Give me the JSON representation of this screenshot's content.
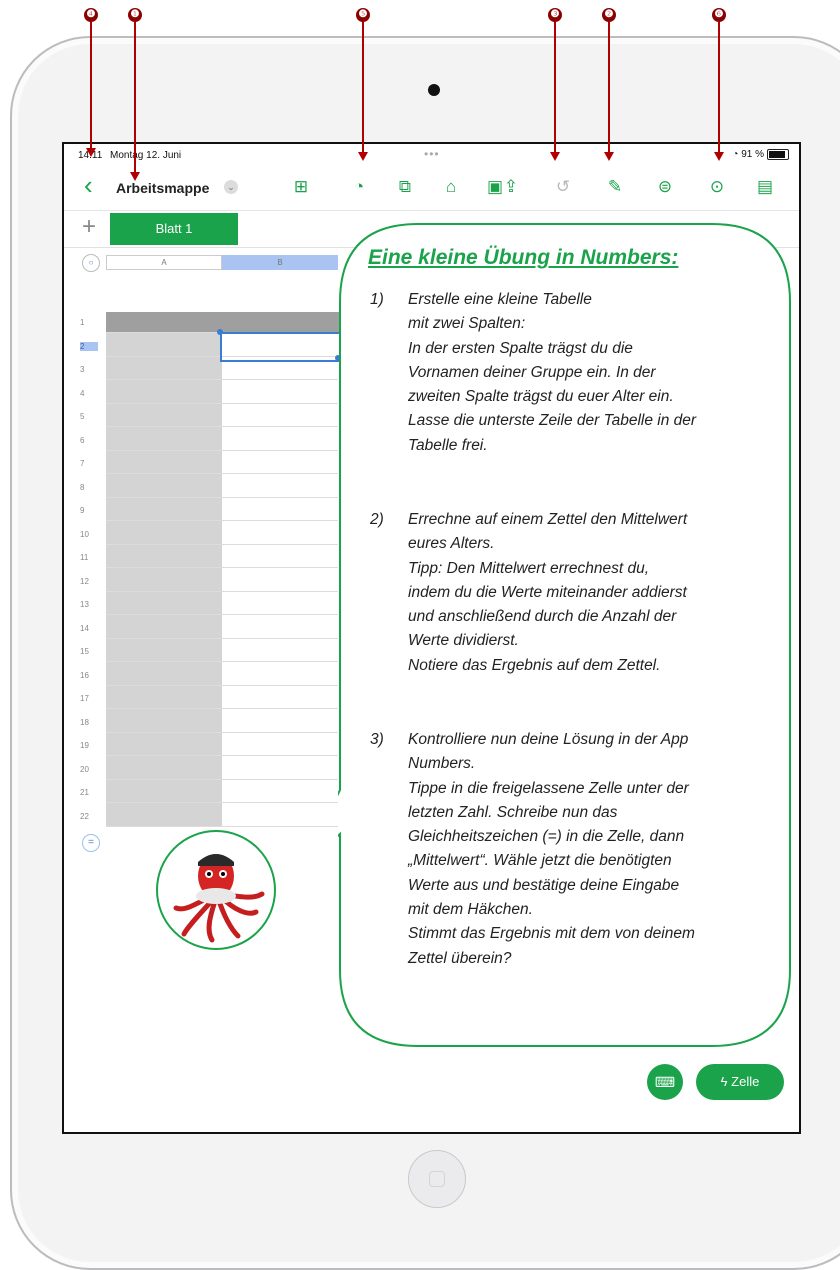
{
  "status": {
    "time": "14:11",
    "date": "Montag 12. Juni",
    "battery": "91 %"
  },
  "toolbar": {
    "back_icon": "chevron-left-icon",
    "doc_title": "Arbeitsmappe",
    "icons": [
      "table-icon",
      "chart-icon",
      "shapes-icon",
      "media-icon",
      "image-icon",
      "share-icon",
      "undo-icon",
      "format-brush-icon",
      "filter-icon",
      "more-icon",
      "organize-icon"
    ]
  },
  "sheet": {
    "add_label": "+",
    "tab_label": "Blatt 1",
    "columns": [
      "A",
      "B"
    ],
    "rows": [
      "1",
      "2",
      "3",
      "4",
      "5",
      "6",
      "7",
      "8",
      "9",
      "10",
      "11",
      "12",
      "13",
      "14",
      "15",
      "16",
      "17",
      "18",
      "19",
      "20",
      "21",
      "22"
    ],
    "selected_row": "2",
    "equals_label": "="
  },
  "bottom": {
    "zelle_label": "Zelle"
  },
  "bubble": {
    "title": "Eine kleine Übung in Numbers:",
    "tasks": [
      {
        "num": "1)",
        "text": "Erstelle eine kleine Tabelle\nmit zwei Spalten:\nIn der ersten Spalte trägst du die\nVornamen deiner Gruppe ein. In der\nzweiten Spalte trägst du euer Alter ein.\nLasse die unterste Zeile der Tabelle in der\nTabelle frei."
      },
      {
        "num": "2)",
        "text": "Errechne auf einem Zettel den Mittelwert\neures Alters.\nTipp: Den Mittelwert errechnest du,\nindem du die Werte miteinander addierst\nund anschließend durch die Anzahl der\nWerte dividierst.\nNotiere das Ergebnis auf dem Zettel."
      },
      {
        "num": "3)",
        "text": "Kontrolliere nun deine Lösung in der App\nNumbers.\nTippe in die freigelassene Zelle unter der\nletzten Zahl. Schreibe nun das\nGleichheitszeichen (=) in die Zelle, dann\n„Mittelwert“. Wähle jetzt die benötigten\nWerte aus und bestätige deine Eingabe\nmit dem Häkchen.\nStimmt das Ergebnis mit dem von deinem\nZettel überein?"
      }
    ]
  },
  "callouts": [
    "❹",
    "❶",
    "❺",
    "❸",
    "❷",
    "❻"
  ],
  "colors": {
    "accent": "#1aa34a",
    "callout": "#8b0000",
    "selection": "#3a7bd6"
  }
}
